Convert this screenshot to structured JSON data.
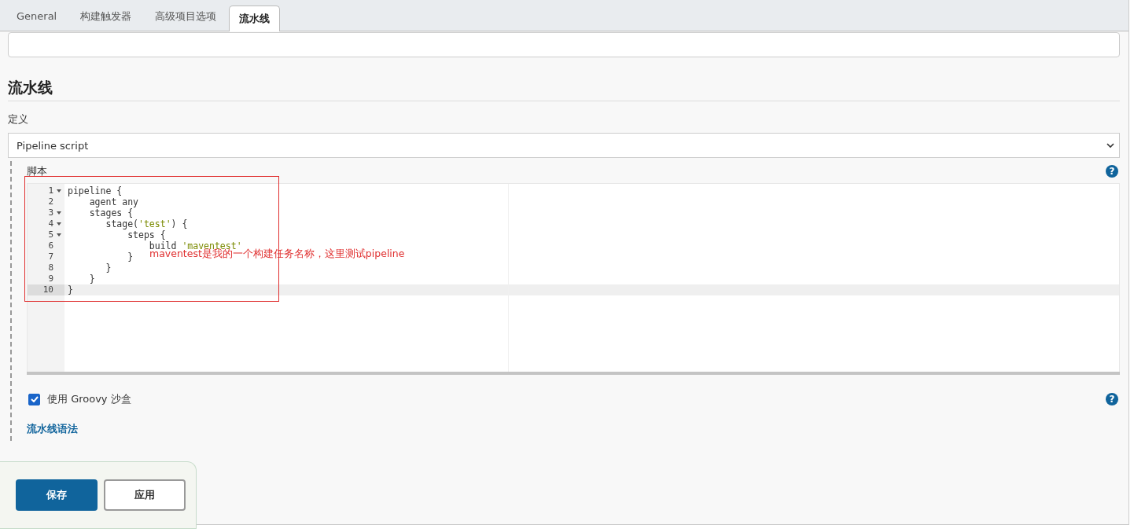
{
  "tabs": [
    {
      "label": "General",
      "selected": false
    },
    {
      "label": "构建触发器",
      "selected": false
    },
    {
      "label": "高级项目选项",
      "selected": false
    },
    {
      "label": "流水线",
      "selected": true
    }
  ],
  "section": {
    "title": "流水线",
    "definition_label": "定义",
    "definition_select": {
      "value": "Pipeline script"
    },
    "script_label": "脚本",
    "script_help": "?",
    "editor": {
      "lines": [
        {
          "number": "1",
          "fold": true,
          "active": false,
          "tokens": [
            {
              "text": "pipeline {",
              "kind": "plain"
            }
          ]
        },
        {
          "number": "2",
          "fold": false,
          "active": false,
          "tokens": [
            {
              "text": "    agent any",
              "kind": "plain"
            }
          ]
        },
        {
          "number": "3",
          "fold": true,
          "active": false,
          "tokens": [
            {
              "text": "    stages {",
              "kind": "plain"
            }
          ]
        },
        {
          "number": "4",
          "fold": true,
          "active": false,
          "tokens": [
            {
              "text": "       stage(",
              "kind": "plain"
            },
            {
              "text": "'test'",
              "kind": "string"
            },
            {
              "text": ") {",
              "kind": "plain"
            }
          ]
        },
        {
          "number": "5",
          "fold": true,
          "active": false,
          "tokens": [
            {
              "text": "           steps {",
              "kind": "plain"
            }
          ]
        },
        {
          "number": "6",
          "fold": false,
          "active": false,
          "tokens": [
            {
              "text": "               build ",
              "kind": "plain"
            },
            {
              "text": "'maventest'",
              "kind": "string"
            }
          ]
        },
        {
          "number": "7",
          "fold": false,
          "active": false,
          "tokens": [
            {
              "text": "           }",
              "kind": "plain"
            }
          ]
        },
        {
          "number": "8",
          "fold": false,
          "active": false,
          "tokens": [
            {
              "text": "       }",
              "kind": "plain"
            }
          ]
        },
        {
          "number": "9",
          "fold": false,
          "active": false,
          "tokens": [
            {
              "text": "    }",
              "kind": "plain"
            }
          ]
        },
        {
          "number": "10",
          "fold": false,
          "active": true,
          "tokens": [
            {
              "text": "}",
              "kind": "plain"
            }
          ]
        }
      ]
    },
    "annotation": "maventest是我的一个构建任务名称，这里测试pipeline",
    "sandbox": {
      "label": "使用 Groovy 沙盒",
      "checked": true,
      "help": "?"
    },
    "syntax_link": "流水线语法"
  },
  "buttons": [
    {
      "label": "保存",
      "kind": "primary"
    },
    {
      "label": "应用",
      "kind": "secondary"
    }
  ]
}
